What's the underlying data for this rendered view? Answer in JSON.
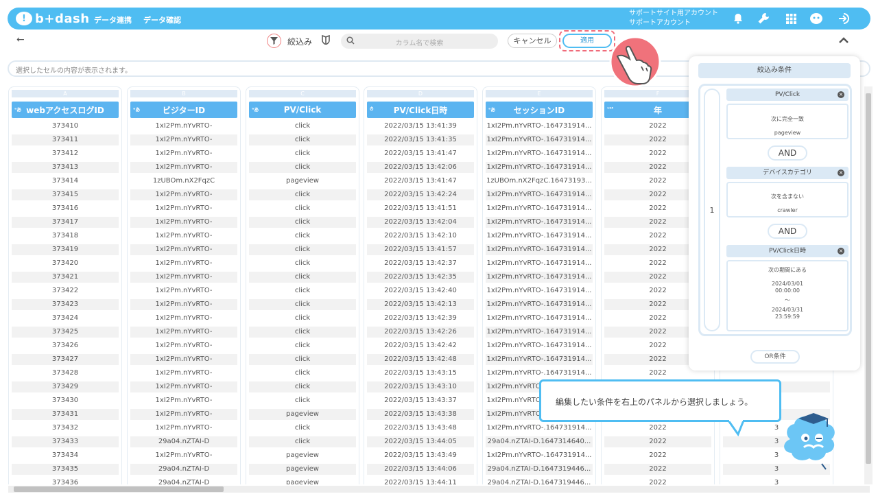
{
  "header": {
    "logo_text": "b+dash",
    "nav": [
      "データ連携",
      "データ確認"
    ],
    "account_line1": "サポートサイト用アカウント",
    "account_line2": "サポートアカウント",
    "brand_color": "#4fbdf2"
  },
  "toolbar": {
    "filter_label": "絞込み",
    "search_placeholder": "カラム名で検索",
    "cancel_label": "キャンセル",
    "apply_label": "適用"
  },
  "cellbar": {
    "placeholder": "選択したセルの内容が表示されます。"
  },
  "columns": [
    {
      "letter": "A",
      "type": "ᵃあ",
      "name": "webアクセスログID"
    },
    {
      "letter": "B",
      "type": "ᵃあ",
      "name": "ビジターID"
    },
    {
      "letter": "C",
      "type": "ᵃあ",
      "name": "PV/Click"
    },
    {
      "letter": "D",
      "type": "⏱",
      "name": "PV/Click日時"
    },
    {
      "letter": "E",
      "type": "ᵃあ",
      "name": "セッションID"
    },
    {
      "letter": "F",
      "type": "¹²³",
      "name": "年"
    },
    {
      "letter": "",
      "type": "",
      "name": ""
    }
  ],
  "rows": [
    [
      "373410",
      "1xI2Pm.nYvRTO-",
      "click",
      "2022/03/15 13:41:39",
      "1xI2Pm.nYvRTO-.164731914...",
      "2022",
      ""
    ],
    [
      "373411",
      "1xI2Pm.nYvRTO-",
      "click",
      "2022/03/15 13:41:35",
      "1xI2Pm.nYvRTO-.164731914...",
      "2022",
      ""
    ],
    [
      "373412",
      "1xI2Pm.nYvRTO-",
      "click",
      "2022/03/15 13:41:47",
      "1xI2Pm.nYvRTO-.164731914...",
      "2022",
      ""
    ],
    [
      "373413",
      "1xI2Pm.nYvRTO-",
      "click",
      "2022/03/15 13:42:06",
      "1xI2Pm.nYvRTO-.164731914...",
      "2022",
      ""
    ],
    [
      "373414",
      "1zUBOm.nX2FqzC",
      "pageview",
      "2022/03/15 13:41:47",
      "1zUBOm.nX2FqzC.16473193...",
      "2022",
      ""
    ],
    [
      "373415",
      "1xI2Pm.nYvRTO-",
      "click",
      "2022/03/15 13:42:24",
      "1xI2Pm.nYvRTO-.164731914...",
      "2022",
      ""
    ],
    [
      "373416",
      "1xI2Pm.nYvRTO-",
      "click",
      "2022/03/15 13:41:51",
      "1xI2Pm.nYvRTO-.164731914...",
      "2022",
      ""
    ],
    [
      "373417",
      "1xI2Pm.nYvRTO-",
      "click",
      "2022/03/15 13:42:04",
      "1xI2Pm.nYvRTO-.164731914...",
      "2022",
      ""
    ],
    [
      "373418",
      "1xI2Pm.nYvRTO-",
      "click",
      "2022/03/15 13:42:10",
      "1xI2Pm.nYvRTO-.164731914...",
      "2022",
      ""
    ],
    [
      "373419",
      "1xI2Pm.nYvRTO-",
      "click",
      "2022/03/15 13:41:57",
      "1xI2Pm.nYvRTO-.164731914...",
      "2022",
      ""
    ],
    [
      "373420",
      "1xI2Pm.nYvRTO-",
      "click",
      "2022/03/15 13:42:37",
      "1xI2Pm.nYvRTO-.164731914...",
      "2022",
      ""
    ],
    [
      "373421",
      "1xI2Pm.nYvRTO-",
      "click",
      "2022/03/15 13:42:35",
      "1xI2Pm.nYvRTO-.164731914...",
      "2022",
      ""
    ],
    [
      "373422",
      "1xI2Pm.nYvRTO-",
      "click",
      "2022/03/15 13:42:40",
      "1xI2Pm.nYvRTO-.164731914...",
      "2022",
      ""
    ],
    [
      "373423",
      "1xI2Pm.nYvRTO-",
      "click",
      "2022/03/15 13:42:13",
      "1xI2Pm.nYvRTO-.164731914...",
      "2022",
      ""
    ],
    [
      "373424",
      "1xI2Pm.nYvRTO-",
      "click",
      "2022/03/15 13:42:39",
      "1xI2Pm.nYvRTO-.164731914...",
      "2022",
      ""
    ],
    [
      "373425",
      "1xI2Pm.nYvRTO-",
      "click",
      "2022/03/15 13:42:26",
      "1xI2Pm.nYvRTO-.164731914...",
      "2022",
      ""
    ],
    [
      "373426",
      "1xI2Pm.nYvRTO-",
      "click",
      "2022/03/15 13:42:42",
      "1xI2Pm.nYvRTO-.164731914...",
      "2022",
      ""
    ],
    [
      "373427",
      "1xI2Pm.nYvRTO-",
      "click",
      "2022/03/15 13:42:48",
      "1xI2Pm.nYvRTO-.164731914...",
      "2022",
      ""
    ],
    [
      "373428",
      "1xI2Pm.nYvRTO-",
      "click",
      "2022/03/15 13:43:15",
      "1xI2Pm.nYvRTO-.164731914...",
      "2022",
      ""
    ],
    [
      "373429",
      "1xI2Pm.nYvRTO-",
      "click",
      "2022/03/15 13:43:10",
      "1xI2Pm.nYvRTO-.164731914...",
      "",
      ""
    ],
    [
      "373430",
      "1xI2Pm.nYvRTO-",
      "click",
      "2022/03/15 13:43:37",
      "1xI2Pm.nYvRTO-.164731914...",
      "",
      ""
    ],
    [
      "373431",
      "1xI2Pm.nYvRTO-",
      "pageview",
      "2022/03/15 13:43:38",
      "1xI2Pm.nYvRTO-.164731914...",
      "",
      ""
    ],
    [
      "373432",
      "1xI2Pm.nYvRTO-",
      "click",
      "2022/03/15 13:43:48",
      "1xI2Pm.nYvRTO-.164731914...",
      "2022",
      "3"
    ],
    [
      "373433",
      "29a04.nZTAI-D",
      "click",
      "2022/03/15 13:44:05",
      "29a04.nZTAI-D.1647314640...",
      "2022",
      "3"
    ],
    [
      "373434",
      "1xI2Pm.nYvRTO-",
      "pageview",
      "2022/03/15 13:43:49",
      "1xI2Pm.nYvRTO-.164731914...",
      "2022",
      "3"
    ],
    [
      "373435",
      "29a04.nZTAI-D",
      "pageview",
      "2022/03/15 13:44:06",
      "29a04.nZTAI-D.1647319446...",
      "2022",
      "3"
    ],
    [
      "373436",
      "29a04.nZTAI-D",
      "pageview",
      "2022/03/15 13:44:11",
      "29a04.nZTAI-D.1647319446...",
      "2022",
      "3"
    ]
  ],
  "panel": {
    "title": "絞込み条件",
    "group_index": "1",
    "conditions": [
      {
        "field": "PV/Click",
        "lines": [
          "次に完全一致",
          "pageview"
        ]
      },
      {
        "field": "デバイスカテゴリ",
        "lines": [
          "次を含まない",
          "crawler"
        ]
      },
      {
        "field": "PV/Click日時",
        "lines": [
          "次の期間にある",
          "2024/03/01",
          "00:00:00",
          "〜",
          "2024/03/31",
          "23:59:59"
        ]
      }
    ],
    "and_label": "AND",
    "or_label": "OR条件"
  },
  "tooltip": {
    "text": "編集したい条件を右上のパネルから選択しましょう。"
  }
}
